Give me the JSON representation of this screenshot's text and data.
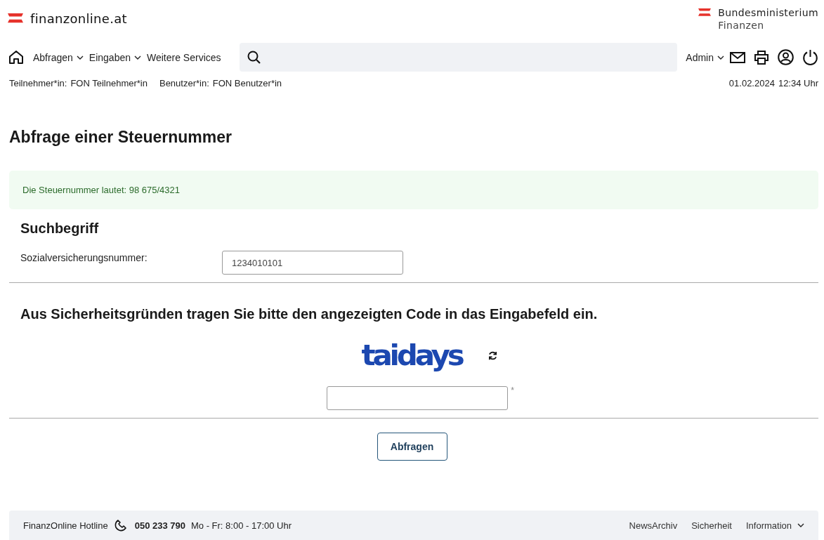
{
  "header": {
    "logo_text": "finanzonline.at",
    "ministry_line1": "Bundesministerium",
    "ministry_line2": "Finanzen"
  },
  "nav": {
    "items": [
      {
        "label": "Abfragen",
        "has_menu": true
      },
      {
        "label": "Eingaben",
        "has_menu": true
      },
      {
        "label": "Weitere Services",
        "has_menu": false
      }
    ],
    "user_menu": "Admin"
  },
  "session": {
    "participant_label": "Teilnehmer*in:",
    "participant": "FON Teilnehmer*in",
    "user_label": "Benutzer*in:",
    "user": "FON Benutzer*in",
    "date": "01.02.2024",
    "time": "12:34 Uhr"
  },
  "page_title": "Abfrage einer Steuernummer",
  "result_message": "Die Steuernummer lautet: 98 675/4321",
  "search_section": {
    "heading": "Suchbegriff",
    "field_label": "Sozialversicherungsnummer:",
    "field_value": "1234010101"
  },
  "captcha": {
    "instruction": "Aus Sicherheitsgründen tragen Sie bitte den angezeigten Code in das Eingabefeld ein.",
    "code": "taidays",
    "required_mark": "*"
  },
  "submit_button": "Abfragen",
  "footer": {
    "hotline_label": "FinanzOnline Hotline",
    "phone": "050 233 790",
    "hours": "Mo - Fr: 8:00 - 17:00 Uhr",
    "links": [
      {
        "label": "NewsArchiv",
        "has_menu": false
      },
      {
        "label": "Sicherheit",
        "has_menu": false
      },
      {
        "label": "Information",
        "has_menu": true
      }
    ]
  }
}
